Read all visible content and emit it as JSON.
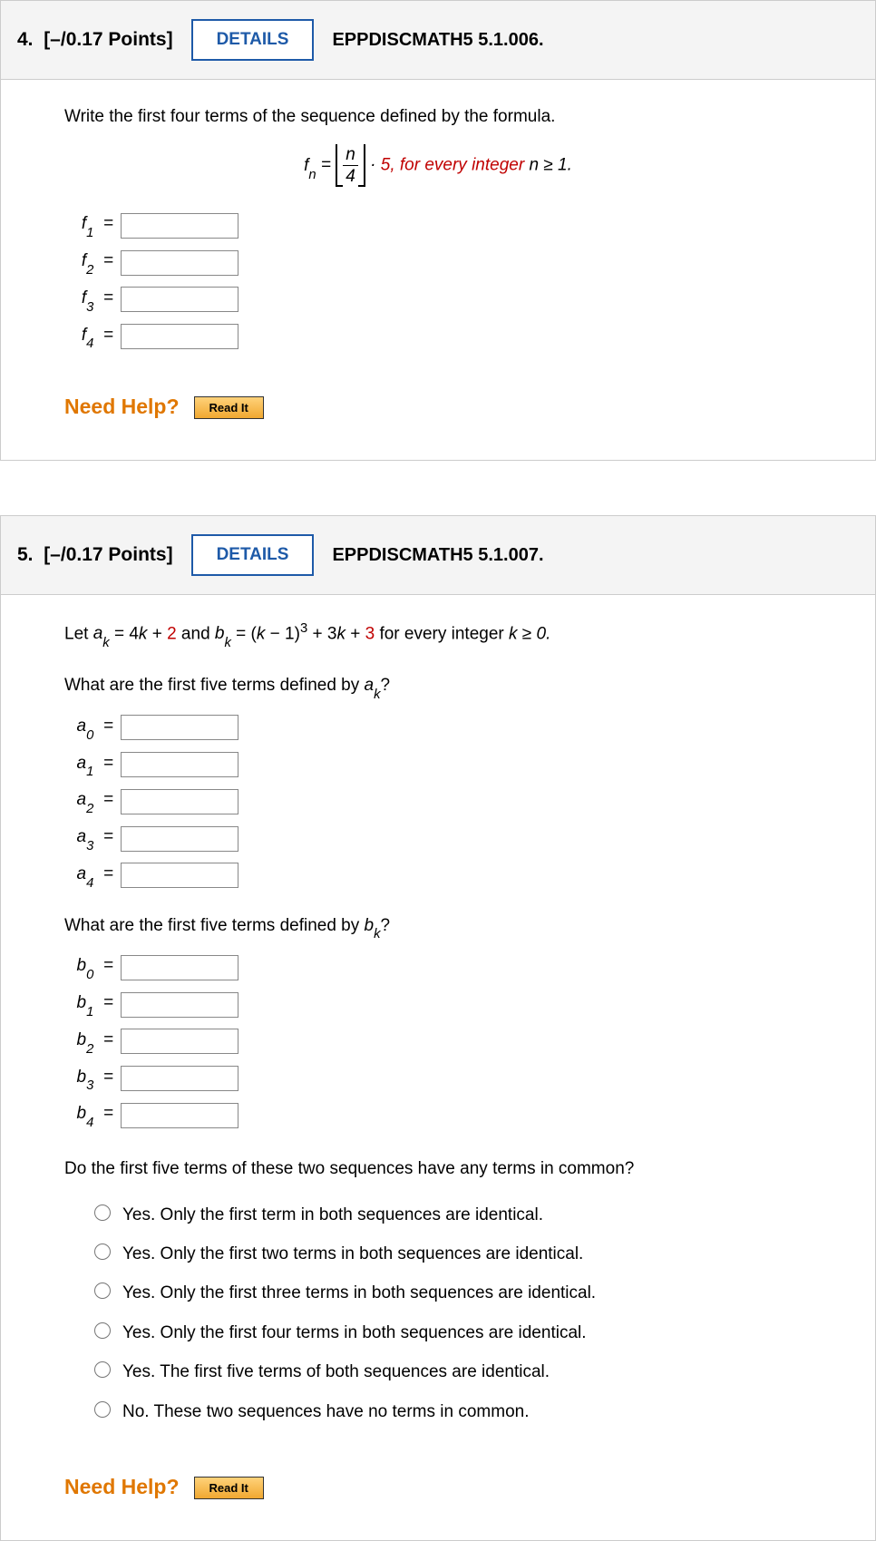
{
  "q4": {
    "header": {
      "num": "4.",
      "points": "[–/0.17 Points]",
      "details": "DETAILS",
      "ref": "EPPDISCMATH5 5.1.006."
    },
    "prompt": "Write the first four terms of the sequence defined by the formula.",
    "formula_tail": "5, for every integer ",
    "formula_cond": "n ≥ 1.",
    "terms": [
      {
        "label_base": "f",
        "label_sub": "1"
      },
      {
        "label_base": "f",
        "label_sub": "2"
      },
      {
        "label_base": "f",
        "label_sub": "3"
      },
      {
        "label_base": "f",
        "label_sub": "4"
      }
    ],
    "need_help": "Need Help?",
    "read_it": "Read It"
  },
  "q5": {
    "header": {
      "num": "5.",
      "points": "[–/0.17 Points]",
      "details": "DETAILS",
      "ref": "EPPDISCMATH5 5.1.007."
    },
    "let_prefix": "Let ",
    "ak_base": "a",
    "ak_sub": "k",
    "eq1": " = 4",
    "k1": "k",
    "plus2": " + ",
    "two": "2",
    "and": " and ",
    "bk_base": "b",
    "bk_sub": "k",
    "eq2": " = (",
    "k2": "k",
    "minus1cubed": " − 1)",
    "sup3": "3",
    "plus3k": " + 3",
    "k3": "k",
    "plus": " + ",
    "three": "3",
    "forall": " for every integer ",
    "cond": "k ≥ 0.",
    "a_section": "What are the first five terms defined by ",
    "a_sec_sym_base": "a",
    "a_sec_sym_sub": "k",
    "qmark": "?",
    "a_terms": [
      {
        "b": "a",
        "s": "0"
      },
      {
        "b": "a",
        "s": "1"
      },
      {
        "b": "a",
        "s": "2"
      },
      {
        "b": "a",
        "s": "3"
      },
      {
        "b": "a",
        "s": "4"
      }
    ],
    "b_section": "What are the first five terms defined by ",
    "b_sec_sym_base": "b",
    "b_sec_sym_sub": "k",
    "b_terms": [
      {
        "b": "b",
        "s": "0"
      },
      {
        "b": "b",
        "s": "1"
      },
      {
        "b": "b",
        "s": "2"
      },
      {
        "b": "b",
        "s": "3"
      },
      {
        "b": "b",
        "s": "4"
      }
    ],
    "mc_question": "Do the first five terms of these two sequences have any terms in common?",
    "mc_options": [
      "Yes. Only the first term in both sequences are identical.",
      "Yes. Only the first two terms in both sequences are identical.",
      "Yes. Only the first three terms in both sequences are identical.",
      "Yes. Only the first four terms in both sequences are identical.",
      "Yes. The first five terms of both sequences are identical.",
      "No. These two sequences have no terms in common."
    ],
    "need_help": "Need Help?",
    "read_it": "Read It"
  }
}
